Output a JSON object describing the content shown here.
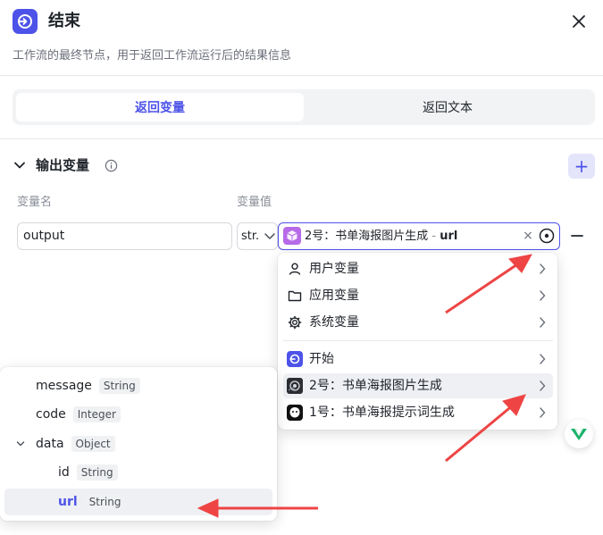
{
  "header": {
    "title": "结束",
    "description": "工作流的最终节点，用于返回工作流运行后的结果信息",
    "icon": "end-node-icon"
  },
  "tabs": [
    {
      "label": "返回变量",
      "active": true
    },
    {
      "label": "返回文本",
      "active": false
    }
  ],
  "output": {
    "section_title": "输出变量",
    "name_column": "变量名",
    "value_column": "变量值",
    "row": {
      "name": "output",
      "type": "str.",
      "ref_node": "2号：书单海报图片生成",
      "ref_separator": " - ",
      "ref_field": "url",
      "clear": "×"
    },
    "add_label": "+"
  },
  "menu": {
    "groups": [
      {
        "label": "用户变量",
        "icon": "user-icon"
      },
      {
        "label": "应用变量",
        "icon": "folder-icon"
      },
      {
        "label": "系统变量",
        "icon": "gear-icon"
      }
    ],
    "nodes": [
      {
        "label": "开始",
        "icon": "start-node-icon"
      },
      {
        "label": "2号：书单海报图片生成",
        "icon": "image-gen-icon",
        "highlighted": true
      },
      {
        "label": "1号：书单海报提示词生成",
        "icon": "llm-icon"
      }
    ]
  },
  "fields": [
    {
      "name": "message",
      "type": "String",
      "level": 0,
      "expandable": false
    },
    {
      "name": "code",
      "type": "Integer",
      "level": 0,
      "expandable": false
    },
    {
      "name": "data",
      "type": "Object",
      "level": 0,
      "expandable": true,
      "expanded": true
    },
    {
      "name": "id",
      "type": "String",
      "level": 1,
      "expandable": false
    },
    {
      "name": "url",
      "type": "String",
      "level": 1,
      "expandable": false,
      "selected": true
    }
  ],
  "colors": {
    "accent": "#4d53e8",
    "annotation_arrow": "#ee4444",
    "ref_badge": "#b66ae8"
  }
}
